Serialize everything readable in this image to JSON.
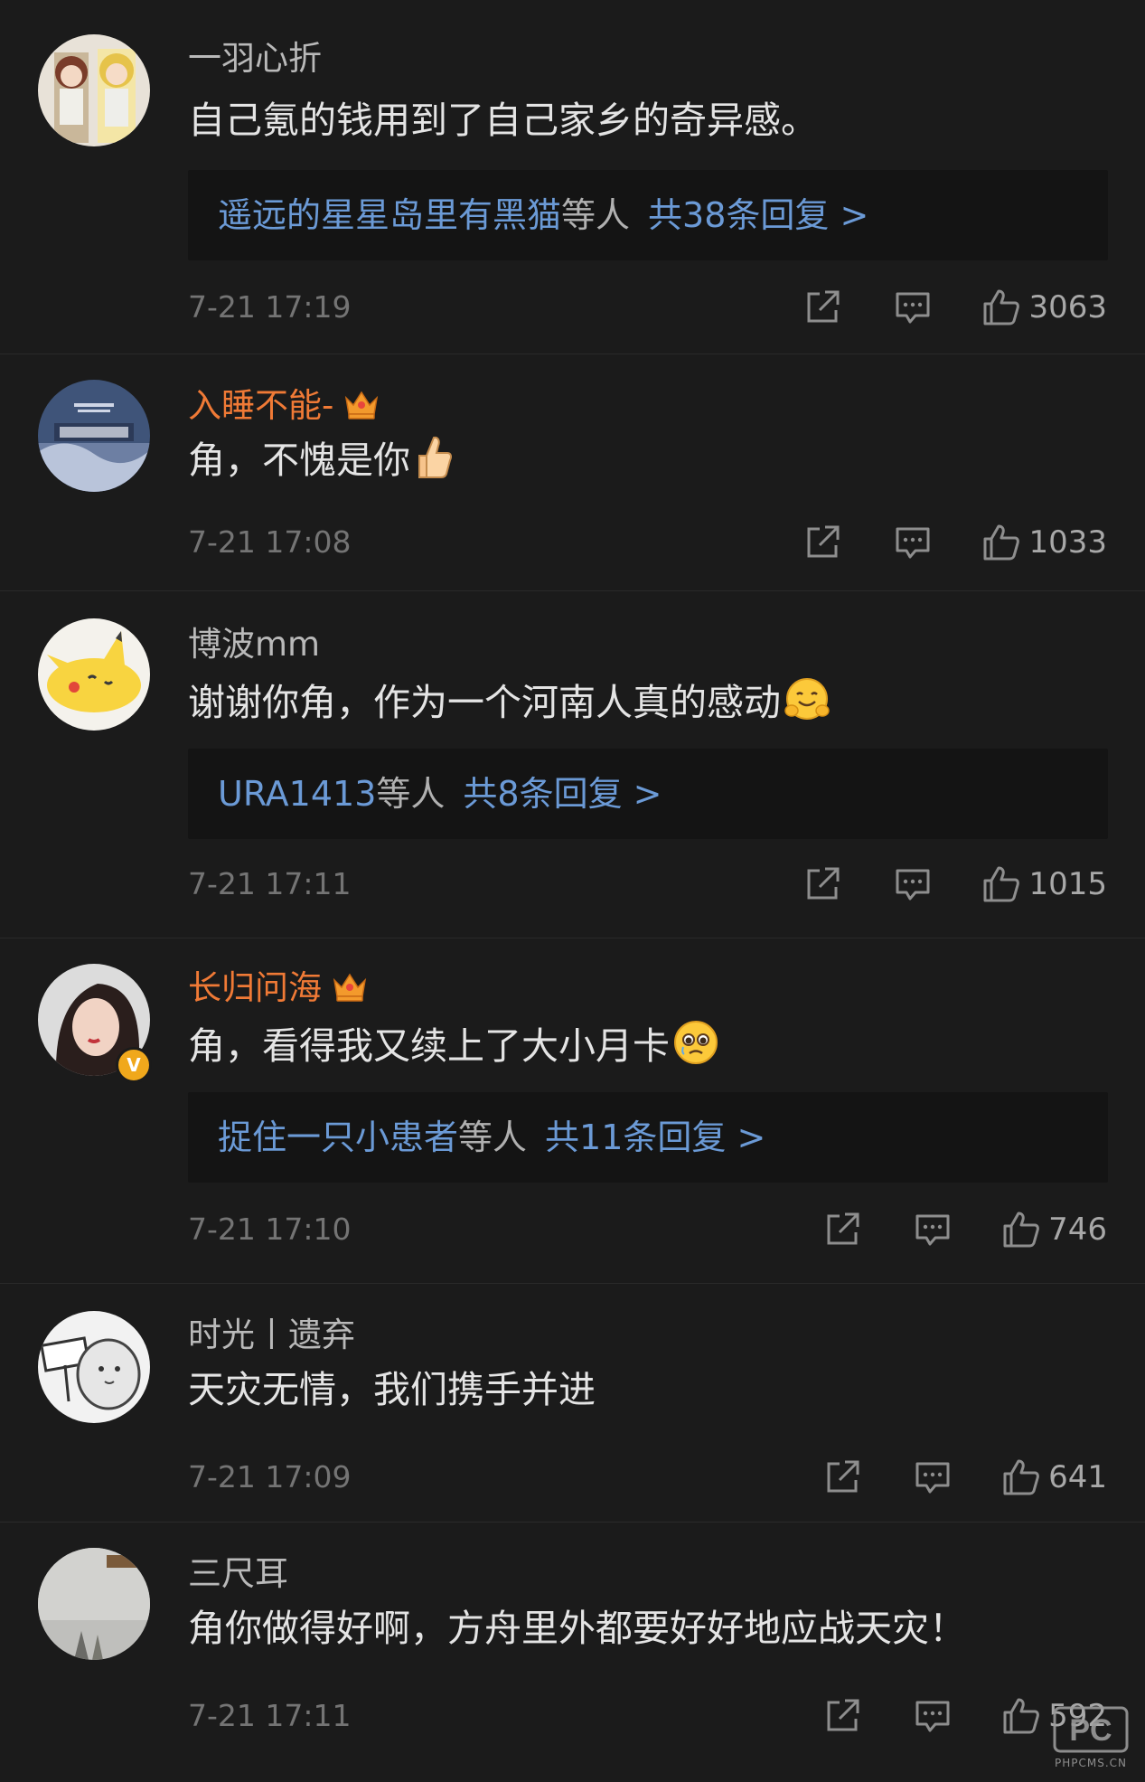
{
  "colors": {
    "background": "#1b1b1b",
    "vip_name": "#f07a36",
    "link_blue": "#6b9ad6",
    "verified_badge": "#f0a81c"
  },
  "icons": [
    "share-icon",
    "comment-icon",
    "thumbs-up-icon",
    "crown-icon",
    "verified-badge-icon"
  ],
  "comments": [
    {
      "username": "一羽心折",
      "vip": false,
      "text": "自己氪的钱用到了自己家乡的奇异感。",
      "emoji": "",
      "reply_users": "遥远的星星岛里有黑猫",
      "reply_etc": "等人",
      "reply_count": "共38条回复 >",
      "time": "7-21 17:19",
      "likes": "3063"
    },
    {
      "username": "入睡不能-",
      "vip": true,
      "text": "角，不愧是你",
      "emoji": "thumbs-up-emoji",
      "time": "7-21 17:08",
      "likes": "1033"
    },
    {
      "username": "博波mm",
      "vip": false,
      "text": "谢谢你角，作为一个河南人真的感动",
      "emoji": "hugging-face-emoji",
      "reply_users": "URA1413",
      "reply_etc": "等人",
      "reply_count": "共8条回复 >",
      "time": "7-21 17:11",
      "likes": "1015"
    },
    {
      "username": "长归问海",
      "vip": true,
      "verified": true,
      "text": "角，看得我又续上了大小月卡",
      "emoji": "pleading-face-emoji",
      "reply_users": "捉住一只小患者",
      "reply_etc": "等人",
      "reply_count": "共11条回复 >",
      "time": "7-21 17:10",
      "likes": "746"
    },
    {
      "username": "时光丨遗弃",
      "vip": false,
      "text": "天灾无情，我们携手并进",
      "emoji": "",
      "time": "7-21 17:09",
      "likes": "641"
    },
    {
      "username": "三尺耳",
      "vip": false,
      "text": "角你做得好啊，方舟里外都要好好地应战天灾！",
      "emoji": "",
      "time": "7-21 17:11",
      "likes": "592"
    }
  ],
  "watermark": {
    "logo": "PC",
    "text": "PHPCMS.CN"
  }
}
